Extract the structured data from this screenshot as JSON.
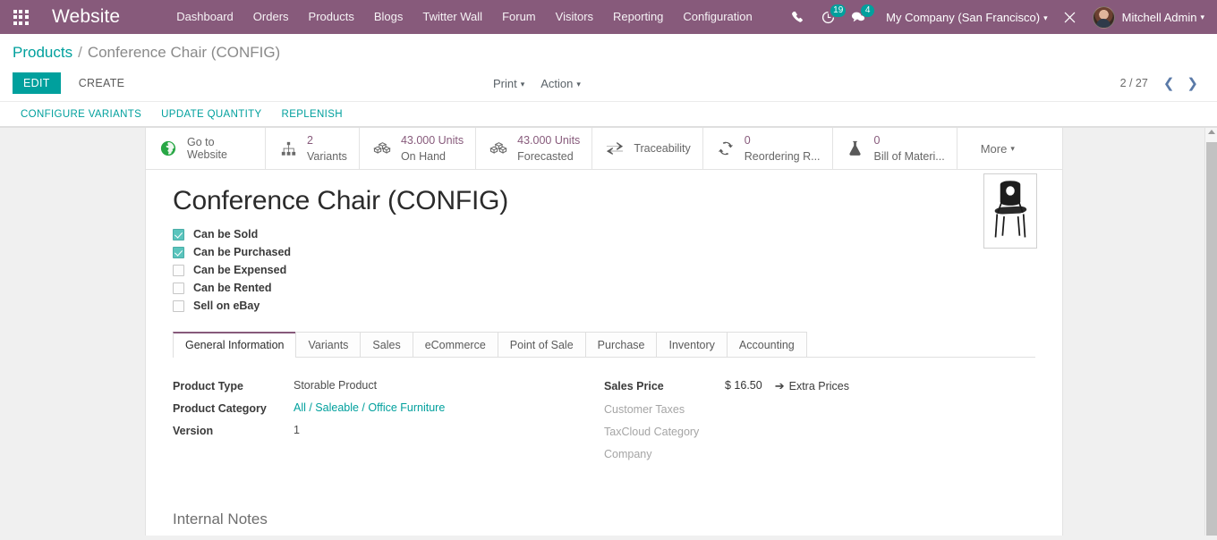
{
  "navbar": {
    "apps_icon": "apps-grid-icon",
    "brand": "Website",
    "menu": [
      {
        "label": "Dashboard"
      },
      {
        "label": "Orders"
      },
      {
        "label": "Products"
      },
      {
        "label": "Blogs"
      },
      {
        "label": "Twitter Wall"
      },
      {
        "label": "Forum"
      },
      {
        "label": "Visitors"
      },
      {
        "label": "Reporting"
      },
      {
        "label": "Configuration"
      }
    ],
    "phone_icon": "phone-icon",
    "activity_icon": "clock-activity-icon",
    "activity_count": "19",
    "messages_icon": "chat-bubble-icon",
    "messages_count": "4",
    "company": "My Company (San Francisco)",
    "tools_icon": "debug-tools-icon",
    "avatar_icon": "user-avatar",
    "user": "Mitchell Admin",
    "brand_color": "#875A7B",
    "badge_color": "#00A09D"
  },
  "breadcrumb": {
    "root": "Products",
    "separator": "/",
    "current": "Conference Chair (CONFIG)"
  },
  "toolbar": {
    "edit_label": "EDIT",
    "create_label": "CREATE",
    "print_label": "Print",
    "action_label": "Action",
    "pager_count": "2 / 27",
    "prev_icon": "chevron-left-icon",
    "next_icon": "chevron-right-icon"
  },
  "subtoolbar": {
    "buttons": [
      {
        "label": "CONFIGURE VARIANTS"
      },
      {
        "label": "UPDATE QUANTITY"
      },
      {
        "label": "REPLENISH"
      }
    ]
  },
  "stat_buttons": [
    {
      "icon": "globe-icon",
      "value": "",
      "label": "Go to Website",
      "single": true
    },
    {
      "icon": "hierarchy-icon",
      "value": "2",
      "label": "Variants",
      "single": false
    },
    {
      "icon": "boxes-icon",
      "value": "43.000 Units",
      "label": "On Hand",
      "single": false
    },
    {
      "icon": "boxes-icon",
      "value": "43.000 Units",
      "label": "Forecasted",
      "single": false
    },
    {
      "icon": "exchange-arrows-icon",
      "value": "",
      "label": "Traceability",
      "single": true
    },
    {
      "icon": "refresh-icon",
      "value": "0",
      "label": "Reordering R...",
      "single": false
    },
    {
      "icon": "flask-icon",
      "value": "0",
      "label": "Bill of Materi...",
      "single": false
    }
  ],
  "more_button": {
    "label": "More",
    "caret_icon": "caret-down-icon"
  },
  "product": {
    "title": "Conference Chair (CONFIG)",
    "image_alt": "black-conference-chair-photo",
    "checkboxes": [
      {
        "label": "Can be Sold",
        "checked": true
      },
      {
        "label": "Can be Purchased",
        "checked": true
      },
      {
        "label": "Can be Expensed",
        "checked": false
      },
      {
        "label": "Can be Rented",
        "checked": false
      },
      {
        "label": "Sell on eBay",
        "checked": false
      }
    ]
  },
  "tabs": [
    {
      "label": "General Information",
      "active": true
    },
    {
      "label": "Variants",
      "active": false
    },
    {
      "label": "Sales",
      "active": false
    },
    {
      "label": "eCommerce",
      "active": false
    },
    {
      "label": "Point of Sale",
      "active": false
    },
    {
      "label": "Purchase",
      "active": false
    },
    {
      "label": "Inventory",
      "active": false
    },
    {
      "label": "Accounting",
      "active": false
    }
  ],
  "general_information": {
    "left": [
      {
        "label": "Product Type",
        "value": "Storable Product",
        "is_link": false,
        "muted_label": false
      },
      {
        "label": "Product Category",
        "value": "All / Saleable / Office Furniture",
        "is_link": true,
        "muted_label": false
      },
      {
        "label": "Version",
        "value": "1",
        "is_link": false,
        "muted_label": false
      }
    ],
    "right": [
      {
        "label": "Sales Price",
        "value": "$ 16.50",
        "muted_label": false
      },
      {
        "label": "Customer Taxes",
        "value": "",
        "muted_label": true
      },
      {
        "label": "TaxCloud Category",
        "value": "",
        "muted_label": true
      },
      {
        "label": "Company",
        "value": "",
        "muted_label": true
      }
    ],
    "extra_prices_label": "Extra Prices",
    "extra_prices_icon": "arrow-right-icon"
  },
  "internal_notes": {
    "heading": "Internal Notes"
  },
  "scrollbar": {
    "up_icon": "scroll-up-arrow-icon"
  }
}
